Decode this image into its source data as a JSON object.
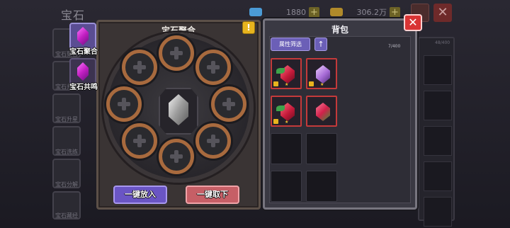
{
  "screen": {
    "title": "宝石"
  },
  "currencies": [
    {
      "icon": "diamond-icon",
      "value": "1880",
      "color": "#4b9bd6"
    },
    {
      "icon": "gold-chest-icon",
      "value": "306.2万",
      "color": "#b08a2a"
    }
  ],
  "side_tabs_background": [
    {
      "label": "宝石聚合"
    },
    {
      "label": "宝石共鸣"
    },
    {
      "label": "宝石升星"
    },
    {
      "label": "宝石洗练"
    },
    {
      "label": "宝石分解"
    },
    {
      "label": "宝石藏经"
    }
  ],
  "right_background_counter": "48/400",
  "fusion": {
    "nav": [
      {
        "label": "宝石聚合",
        "active": true
      },
      {
        "label": "宝石共鸣",
        "active": false
      }
    ],
    "title": "宝石聚合",
    "info_icon": "!",
    "slot_count": 8,
    "put_all_label": "一键放入",
    "take_all_label": "一键取下"
  },
  "backpack": {
    "title": "背包",
    "filter_label": "属性筛选",
    "sort_icon": "↑",
    "capacity": "7/400",
    "items": [
      {
        "icon": "green-gem-icon",
        "filled": true,
        "locked": true,
        "color": "#d64a5c"
      },
      {
        "icon": "purple-gem-icon",
        "filled": true,
        "locked": true,
        "color": "#a66bd6"
      },
      {
        "icon": "green-gem-icon",
        "filled": true,
        "locked": true,
        "color": "#d64a5c"
      },
      {
        "icon": "red-gem-icon",
        "filled": true,
        "locked": false,
        "color": "#d64a5c"
      },
      {
        "filled": false
      },
      {
        "filled": false
      },
      {
        "filled": false
      },
      {
        "filled": false
      }
    ]
  },
  "close_icon": "✕",
  "colors": {
    "accent_purple": "#6a55c4",
    "accent_red": "#c65f66",
    "close_red": "#d93434"
  }
}
